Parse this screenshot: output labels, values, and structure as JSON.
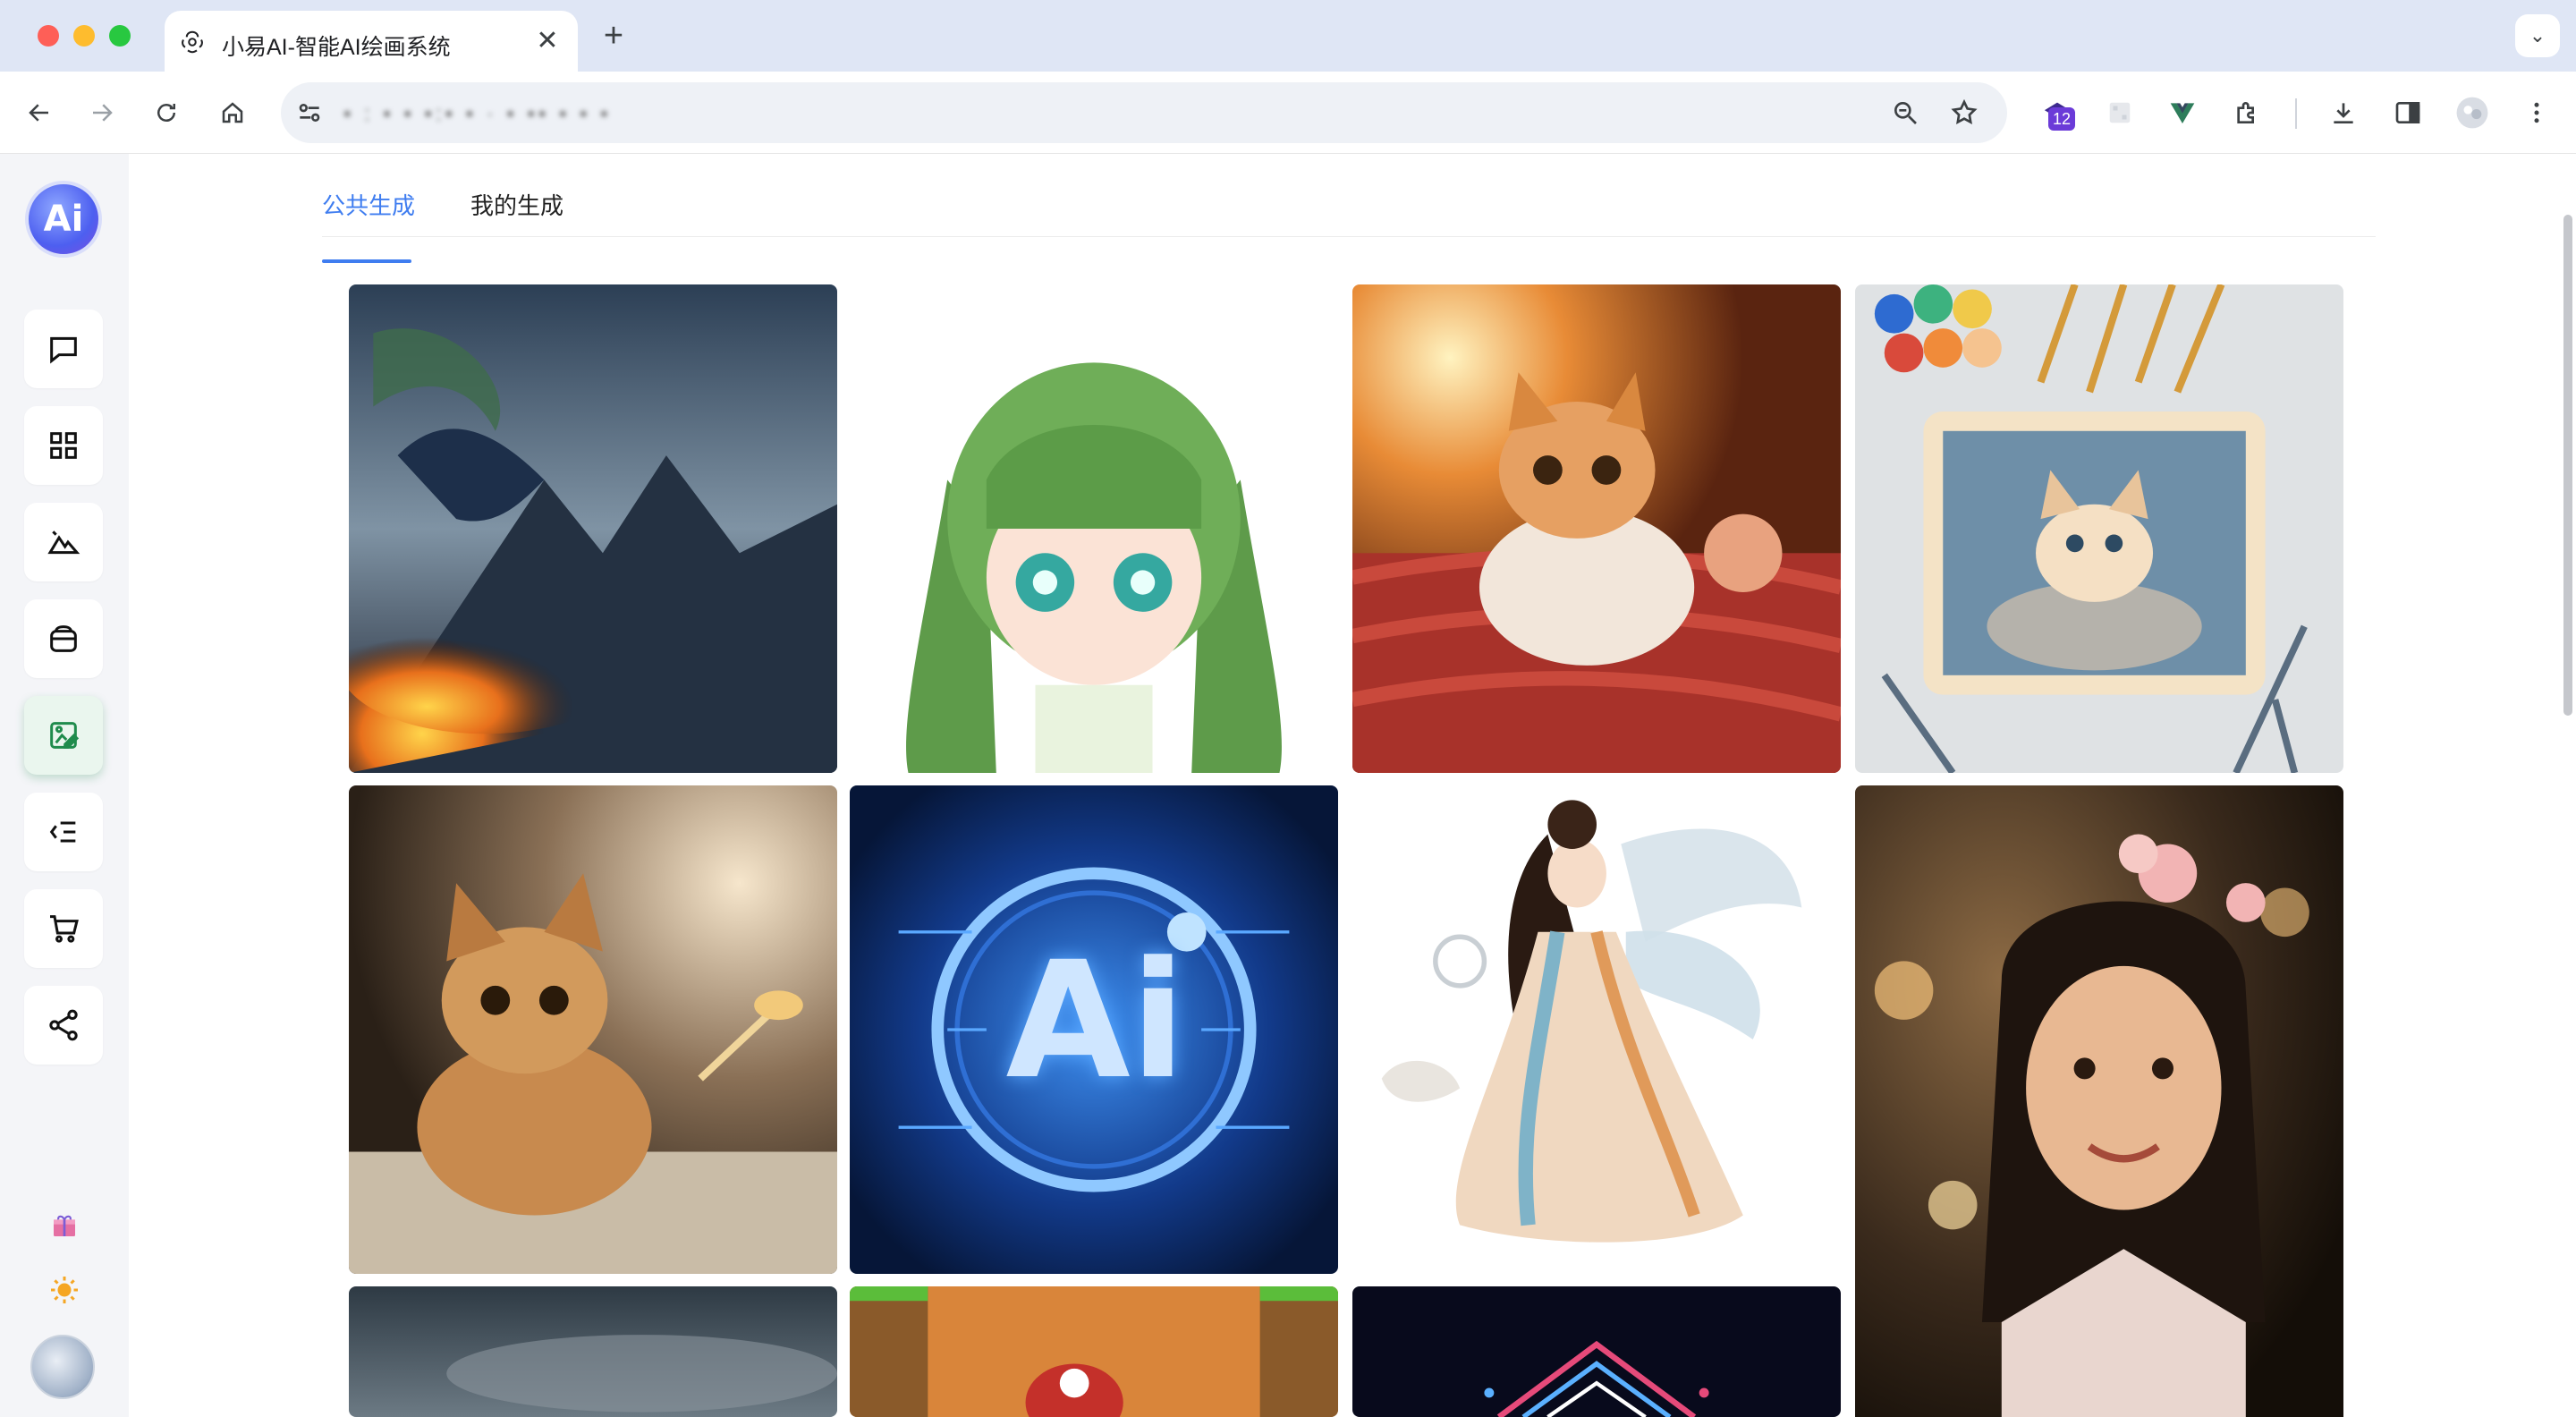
{
  "browser": {
    "tab_title": "小易AI-智能AI绘画系统",
    "close_glyph": "✕",
    "new_tab_glyph": "+",
    "tab_menu_glyph": "⌄",
    "url_text": "• : • • •:• • ·  • •• • • •",
    "extension_badge": "12",
    "icons": [
      "back-icon",
      "forward-icon",
      "reload-icon",
      "home-icon",
      "site-settings-icon",
      "zoom-icon",
      "bookmark-star-icon",
      "extension-badge-icon",
      "extension-icon",
      "vue-devtools-icon",
      "extensions-puzzle-icon",
      "download-icon",
      "side-panel-icon",
      "profile-icon",
      "more-menu-icon"
    ]
  },
  "sidebar": {
    "logo_text": "Ai",
    "items": [
      {
        "name": "chat",
        "icon": "chat-bubble-icon"
      },
      {
        "name": "apps",
        "icon": "grid-icon"
      },
      {
        "name": "gallery",
        "icon": "mountain-icon"
      },
      {
        "name": "wallet",
        "icon": "wallet-icon"
      },
      {
        "name": "drawing",
        "icon": "image-edit-icon",
        "active": true
      },
      {
        "name": "outline",
        "icon": "list-collapse-icon"
      },
      {
        "name": "shop",
        "icon": "cart-icon"
      },
      {
        "name": "share",
        "icon": "share-icon"
      }
    ],
    "bottom": [
      "gift-icon",
      "sun-icon",
      "user-avatar"
    ]
  },
  "tabs": [
    {
      "label": "公共生成",
      "active": true
    },
    {
      "label": "我的生成",
      "active": false
    }
  ],
  "gallery": {
    "items": [
      {
        "subject": "dragon breathing fire over mountains"
      },
      {
        "subject": "green twin-tail chibi anime girl"
      },
      {
        "subject": "fluffy kitten on red knit blanket"
      },
      {
        "subject": "kitten painting with watercolors and pencils"
      },
      {
        "subject": "tabby cat sitting with feather"
      },
      {
        "subject": "glowing blue AI circuit emblem"
      },
      {
        "subject": "hanfu fairy girl illustration"
      },
      {
        "subject": "portrait of girl with flower hairpin"
      },
      {
        "subject": "dark cloudy sky landscape"
      },
      {
        "subject": "game-style orange world"
      },
      {
        "subject": "neon circuit diamond pattern"
      }
    ],
    "ai_badge_text": "Ai"
  },
  "colors": {
    "accent": "#3f7df0",
    "active_nav": "#1f8b4c",
    "sidebar_bg": "#f4f5f8",
    "tab_strip": "#dfe6f5"
  }
}
